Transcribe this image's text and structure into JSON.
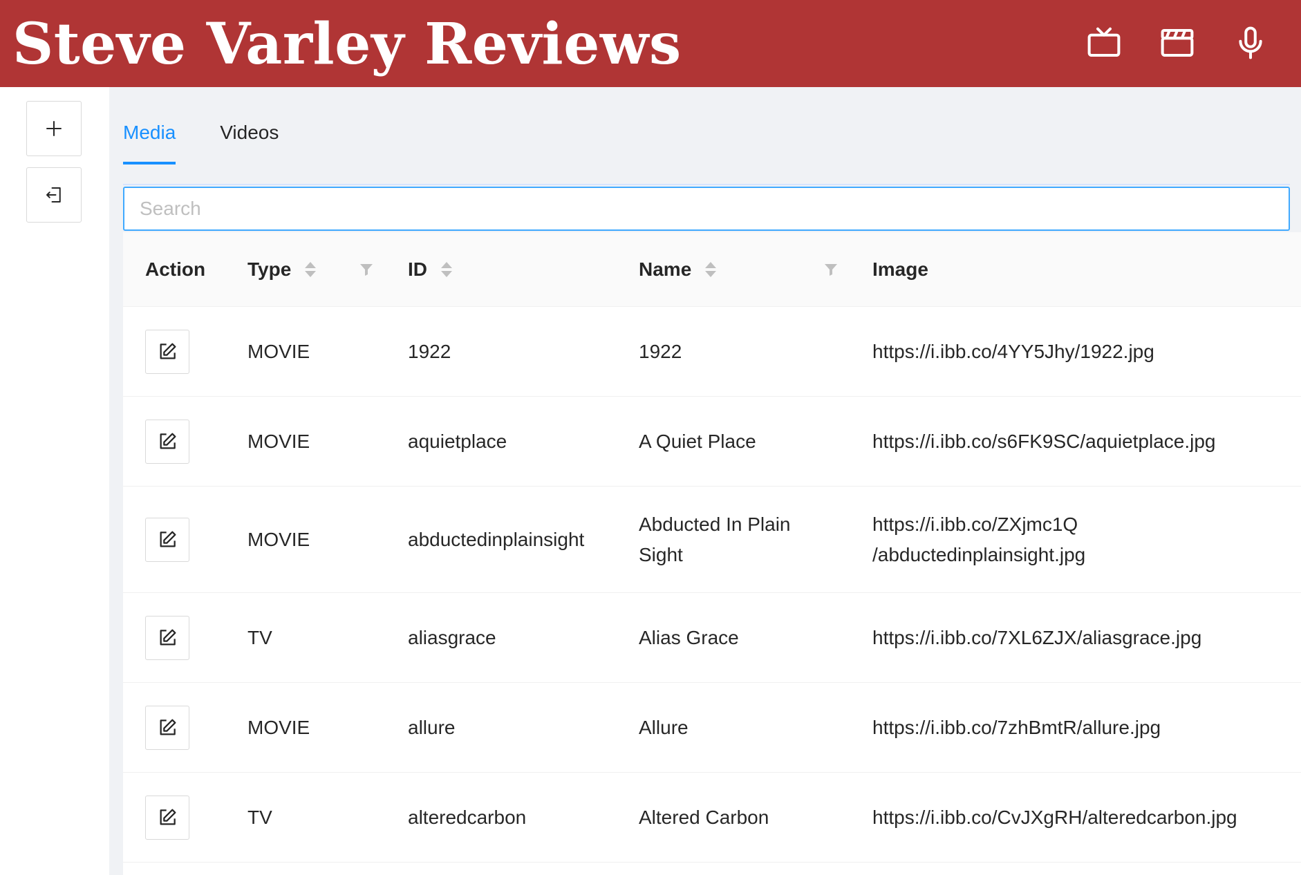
{
  "header": {
    "title": "Steve Varley Reviews",
    "icons": [
      "tv-icon",
      "clapperboard-icon",
      "microphone-icon"
    ],
    "background": "#b03535"
  },
  "sidebar": {
    "buttons": [
      "plus-icon",
      "logout-icon"
    ]
  },
  "tabs": [
    {
      "label": "Media",
      "active": true
    },
    {
      "label": "Videos",
      "active": false
    }
  ],
  "search": {
    "placeholder": "Search",
    "value": ""
  },
  "table": {
    "columns": {
      "action": "Action",
      "type": "Type",
      "id": "ID",
      "name": "Name",
      "image": "Image"
    },
    "rows": [
      {
        "type": "MOVIE",
        "id": "1922",
        "name": "1922",
        "image": "https://i.ibb.co/4YY5Jhy/1922.jpg"
      },
      {
        "type": "MOVIE",
        "id": "aquietplace",
        "name": "A Quiet Place",
        "image": "https://i.ibb.co/s6FK9SC/aquietplace.jpg"
      },
      {
        "type": "MOVIE",
        "id": "abductedinplainsight",
        "name_line1": "Abducted In Plain",
        "name_line2": "Sight",
        "image_line1": "https://i.ibb.co/ZXjmc1Q",
        "image_line2": "/abductedinplainsight.jpg"
      },
      {
        "type": "TV",
        "id": "aliasgrace",
        "name": "Alias Grace",
        "image": "https://i.ibb.co/7XL6ZJX/aliasgrace.jpg"
      },
      {
        "type": "MOVIE",
        "id": "allure",
        "name": "Allure",
        "image": "https://i.ibb.co/7zhBmtR/allure.jpg"
      },
      {
        "type": "TV",
        "id": "alteredcarbon",
        "name": "Altered Carbon",
        "image": "https://i.ibb.co/CvJXgRH/alteredcarbon.jpg"
      }
    ]
  },
  "colors": {
    "accent": "#1890ff",
    "brand": "#b03535"
  }
}
